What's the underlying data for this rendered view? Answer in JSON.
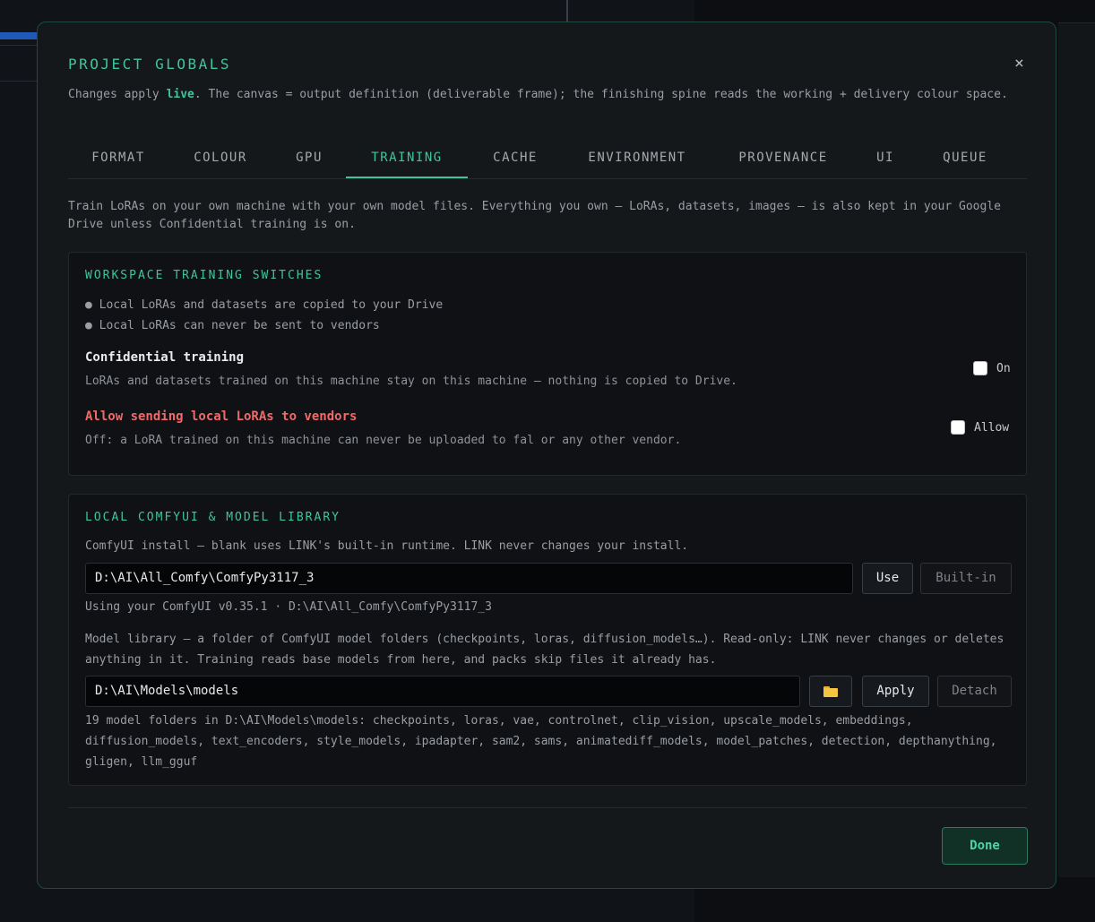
{
  "modal": {
    "title": "PROJECT GLOBALS",
    "close_icon": "×",
    "subtitle_pre": "Changes apply ",
    "subtitle_live": "live",
    "subtitle_post": ". The canvas = output definition (deliverable frame); the finishing spine reads the working + delivery colour space."
  },
  "tabs": [
    {
      "label": "FORMAT"
    },
    {
      "label": "COLOUR"
    },
    {
      "label": "GPU"
    },
    {
      "label": "TRAINING",
      "active": true
    },
    {
      "label": "CACHE"
    },
    {
      "label": "ENVIRONMENT"
    },
    {
      "label": "PROVENANCE"
    },
    {
      "label": "UI"
    },
    {
      "label": "QUEUE"
    }
  ],
  "intro": "Train LoRAs on your own machine with your own model files. Everything you own — LoRAs, datasets, images — is also kept in your Google Drive unless Confidential training is on.",
  "switches": {
    "title": "WORKSPACE TRAINING SWITCHES",
    "bullets": [
      "● Local LoRAs and datasets are copied to your Drive",
      "● Local LoRAs can never be sent to vendors"
    ],
    "confidential": {
      "title": "Confidential training",
      "desc": "LoRAs and datasets trained on this machine stay on this machine — nothing is copied to Drive.",
      "checkbox_label": "On",
      "checked": false
    },
    "vendors": {
      "title": "Allow sending local LoRAs to vendors",
      "desc": "Off: a LoRA trained on this machine can never be uploaded to fal or any other vendor.",
      "checkbox_label": "Allow",
      "checked": false
    }
  },
  "library": {
    "title": "LOCAL COMFYUI & MODEL LIBRARY",
    "install_label": "ComfyUI install — blank uses LINK's built-in runtime. LINK never changes your install.",
    "install_value": "D:\\AI\\All_Comfy\\ComfyPy3117_3",
    "use_button": "Use",
    "builtin_button": "Built-in",
    "install_status": "Using your ComfyUI v0.35.1 · D:\\AI\\All_Comfy\\ComfyPy3117_3",
    "model_label": "Model library — a folder of ComfyUI model folders (checkpoints, loras, diffusion_models…). Read-only: LINK never changes or deletes anything in it. Training reads base models from here, and packs skip files it already has.",
    "model_value": "D:\\AI\\Models\\models",
    "apply_button": "Apply",
    "detach_button": "Detach",
    "model_status": "19 model folders in D:\\AI\\Models\\models: checkpoints, loras, vae, controlnet, clip_vision, upscale_models, embeddings, diffusion_models, text_encoders, style_models, ipadapter, sam2, sams, animatediff_models, model_patches, detection, depthanything, gligen, llm_gguf"
  },
  "footer": {
    "done_button": "Done"
  },
  "colors": {
    "accent": "#3fc59a",
    "danger": "#f06a6a",
    "folder": "#f5c542"
  },
  "icons": {
    "close": "close-icon",
    "folder": "folder-icon"
  }
}
